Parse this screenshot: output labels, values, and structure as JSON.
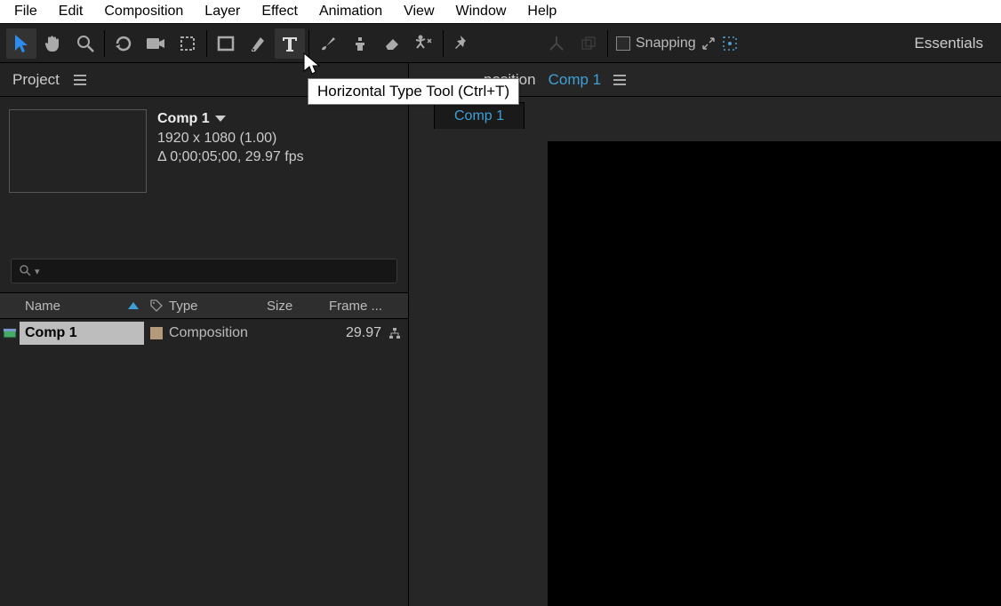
{
  "menu": {
    "items": [
      "File",
      "Edit",
      "Composition",
      "Layer",
      "Effect",
      "Animation",
      "View",
      "Window",
      "Help"
    ]
  },
  "toolbar": {
    "tools": [
      "selection",
      "hand",
      "zoom",
      "orbit",
      "camera",
      "roi",
      "rectangle",
      "pen",
      "type",
      "brush",
      "clone",
      "eraser",
      "puppet",
      "pin"
    ],
    "tooltip": "Horizontal Type Tool (Ctrl+T)",
    "snapping_label": "Snapping",
    "workspace": "Essentials"
  },
  "project": {
    "tab_label": "Project",
    "comp": {
      "name": "Comp 1",
      "resolution": "1920 x 1080 (1.00)",
      "duration": "Δ 0;00;05;00, 29.97 fps"
    },
    "columns": {
      "name": "Name",
      "type": "Type",
      "size": "Size",
      "frame": "Frame ..."
    },
    "row": {
      "name": "Comp 1",
      "type": "Composition",
      "frame_rate": "29.97"
    }
  },
  "viewer": {
    "panel_label": "position",
    "active_comp": "Comp 1",
    "tab": "Comp 1"
  }
}
